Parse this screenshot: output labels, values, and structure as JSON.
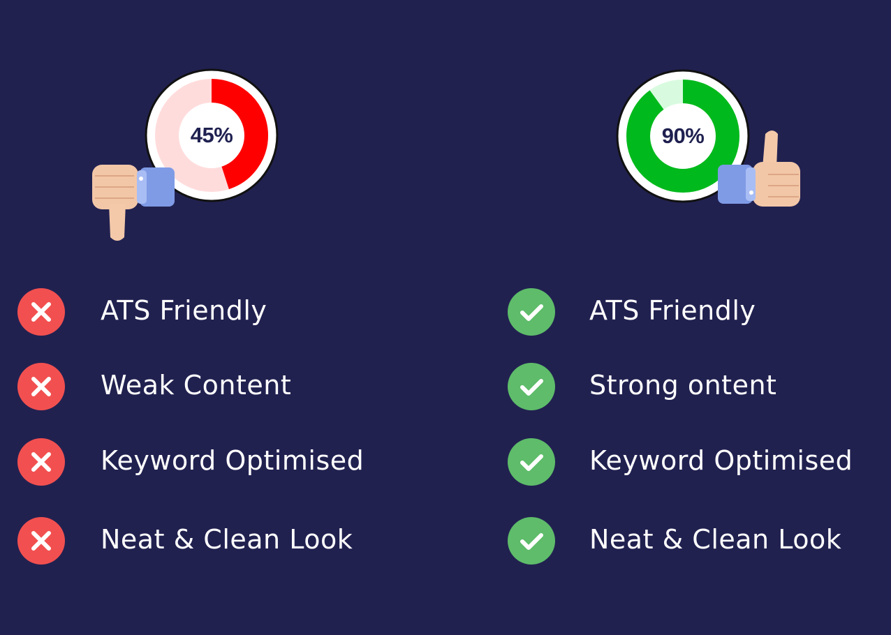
{
  "colors": {
    "background": "#212150",
    "bad_accent": "#ff0000",
    "bad_track": "#ffdcdc",
    "good_accent": "#00b91c",
    "good_track": "#d8fbdf",
    "cross_badge": "#f25050",
    "check_badge": "#5ebc6a",
    "text": "#ffffff",
    "gauge_text": "#1f2050"
  },
  "left": {
    "score": {
      "value": 45,
      "label": "45%"
    },
    "hand_icon": "thumbs-down-icon",
    "status_icon": "cross-icon",
    "items": [
      {
        "label": "ATS Friendly"
      },
      {
        "label": "Weak Content"
      },
      {
        "label": "Keyword Optimised"
      },
      {
        "label": "Neat & Clean Look"
      }
    ]
  },
  "right": {
    "score": {
      "value": 90,
      "label": "90%"
    },
    "hand_icon": "thumbs-up-icon",
    "status_icon": "check-icon",
    "items": [
      {
        "label": "ATS Friendly"
      },
      {
        "label": "Strong ontent"
      },
      {
        "label": "Keyword Optimised"
      },
      {
        "label": "Neat & Clean Look"
      }
    ]
  }
}
